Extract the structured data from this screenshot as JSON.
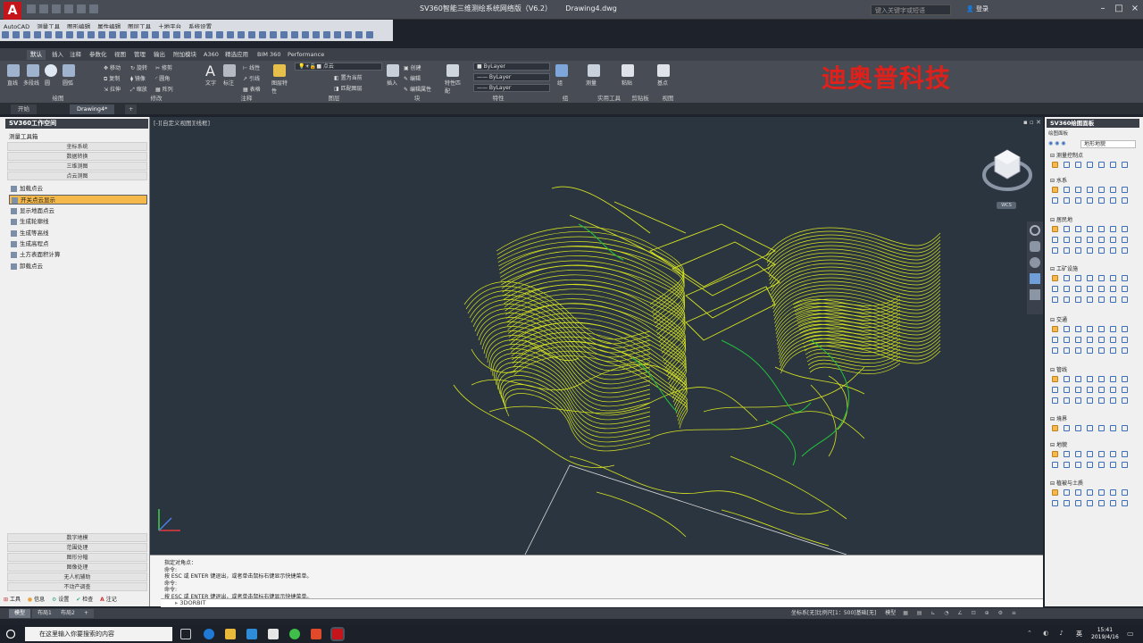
{
  "titlebar": {
    "app_title": "SV360智能三维测绘系统网络版（V6.2）",
    "document": "Drawing4.dwg",
    "search_placeholder": "键入关键字或短语",
    "login_label": "登录"
  },
  "menus": [
    "AutoCAD",
    "测量工具",
    "图形编辑",
    "属性编辑",
    "图层工具",
    "土地平台",
    "系统设置"
  ],
  "ribbon_tabs": [
    "默认",
    "插入",
    "注释",
    "参数化",
    "视图",
    "管理",
    "输出",
    "附加模块",
    "A360",
    "精选应用",
    "BIM 360",
    "Performance"
  ],
  "ribbon": {
    "groups": [
      "绘图",
      "修改",
      "注释",
      "图层",
      "块",
      "特性",
      "组",
      "实用工具",
      "剪贴板",
      "视图"
    ],
    "draw": [
      "直线",
      "多段线",
      "圆",
      "圆弧"
    ],
    "modify": [
      "移动",
      "旋转",
      "修剪",
      "复制",
      "镜像",
      "圆角",
      "拉伸",
      "缩放",
      "阵列"
    ],
    "annotate": [
      "文字",
      "标注",
      "线性",
      "引线",
      "表格"
    ],
    "layer": [
      "图层特性",
      "点云",
      "置为当前",
      "匹配图层"
    ],
    "block": [
      "插入",
      "创建",
      "编辑",
      "编辑属性"
    ],
    "properties": [
      "特性匹配",
      "ByLayer",
      "ByLayer",
      "ByLayer"
    ],
    "group_label": "组",
    "measure_label": "测量",
    "paste_label": "粘贴",
    "base_label": "基点"
  },
  "company_watermark": "迪奥普科技",
  "doc_tabs": [
    "开始",
    "Drawing4*"
  ],
  "left_panel": {
    "title": "SV360工作空间",
    "section": "测量工具箱",
    "top_buttons": [
      "坐标系统",
      "数据转换",
      "三维测图",
      "点云测图"
    ],
    "items": [
      "加载点云",
      "开关点云显示",
      "显示地面点云",
      "生成轮廓线",
      "生成等高线",
      "生成高程点",
      "土方表面积计算",
      "卸载点云"
    ],
    "selected_index": 1,
    "bottom_buttons": [
      "数字地模",
      "范围处理",
      "图形分幅",
      "图像处理",
      "无人机辅助",
      "不动产调查"
    ],
    "bottom_tabs": [
      "工具",
      "信息",
      "设置",
      "检查",
      "注记"
    ]
  },
  "viewport": {
    "label": "[-][自定义视图][线框]",
    "wcs": "WCS"
  },
  "command": {
    "history": [
      "指定对角点：",
      "命令:",
      "按 ESC 或 ENTER 键退出，或者单击鼠标右键显示快捷菜单。",
      "命令:",
      "命令:",
      "按 ESC 或 ENTER 键退出，或者单击鼠标右键显示快捷菜单。"
    ],
    "input": "3DORBIT"
  },
  "right_panel": {
    "title": "SV360绘图面板",
    "subtitle": "绘图面板",
    "combo": "地形地貌",
    "sections": [
      "测量控制点",
      "水系",
      "居民地",
      "工矿设施",
      "交通",
      "管线",
      "境界",
      "地貌",
      "植被与土质"
    ]
  },
  "layout_tabs": [
    "模型",
    "布局1",
    "布局2"
  ],
  "status": {
    "coord": "坐标系[无]比例尺[1：500]基础[无]",
    "model": "模型"
  },
  "taskbar": {
    "search_placeholder": "在这里输入你要搜索的内容",
    "time": "15:41",
    "date": "2019/4/16",
    "ime": "英"
  },
  "colors": {
    "accent": "#f5b84a",
    "contour": "#d8e620",
    "contour_green": "#22c33a",
    "brand_red": "#e0201a"
  }
}
